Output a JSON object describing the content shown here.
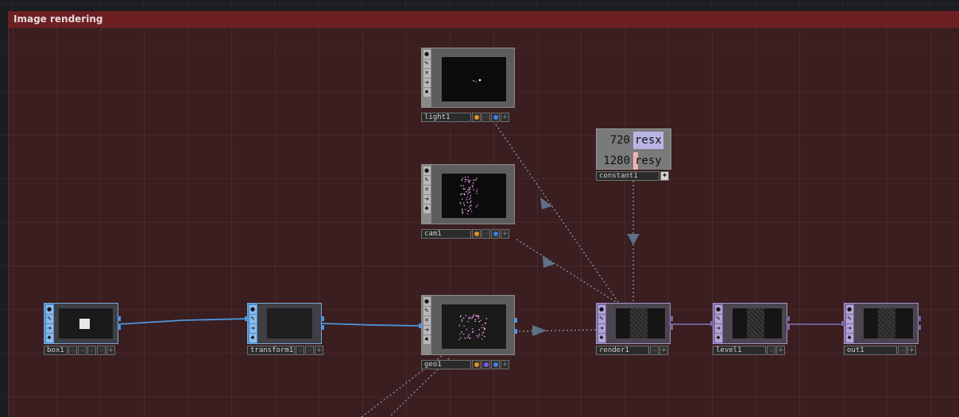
{
  "annotation": {
    "title": "Image rendering"
  },
  "nodes": {
    "light1": {
      "label": "light1"
    },
    "cam1": {
      "label": "cam1"
    },
    "constant1": {
      "label": "constant1",
      "channels": [
        {
          "value": "720",
          "name": "resx"
        },
        {
          "value": "1280",
          "name": "resy"
        }
      ]
    },
    "box1": {
      "label": "box1"
    },
    "transform1": {
      "label": "transform1"
    },
    "geo1": {
      "label": "geo1"
    },
    "render1": {
      "label": "render1"
    },
    "level1": {
      "label": "level1"
    },
    "out1": {
      "label": "out1"
    }
  },
  "colors": {
    "annotation_header": "#6e1f22",
    "annotation_body": "#3a1e20",
    "sop_wire": "#4d96e0",
    "top_wire": "#7c6aa6",
    "dependency_link": "#8a97a6",
    "flag_orange": "#e0901e",
    "flag_blue": "#3f7fe8",
    "flag_purple": "#7a5ae0"
  }
}
